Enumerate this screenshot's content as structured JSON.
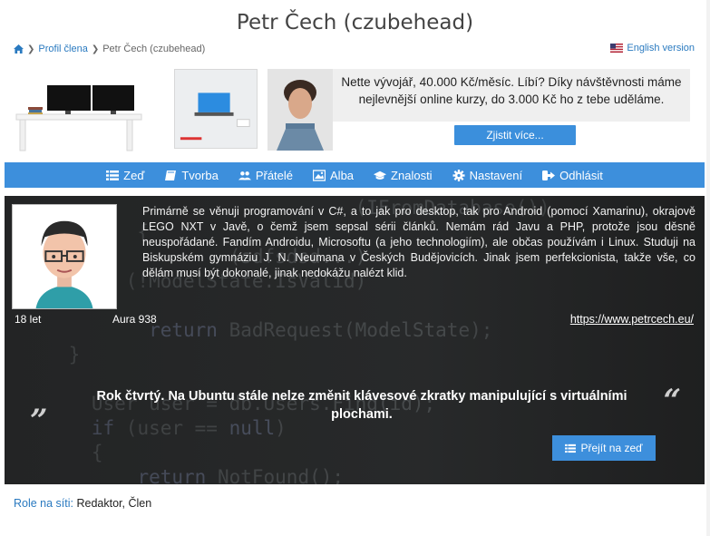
{
  "page": {
    "title": "Petr Čech (czubehead)"
  },
  "breadcrumb": {
    "items": [
      "Profil člena",
      "Petr Čech (czubehead)"
    ]
  },
  "language": {
    "label": "English version"
  },
  "banner": {
    "ad_text": "Nette vývojář, 40.000 Kč/měsíc. Líbí? Díky návštěvnosti máme nejlevnější online kurzy, do 3.000 Kč ho z tebe uděláme.",
    "button": "Zjistit více..."
  },
  "nav": {
    "items": [
      {
        "label": "Zeď",
        "icon": "list-icon"
      },
      {
        "label": "Tvorba",
        "icon": "book-icon"
      },
      {
        "label": "Přátelé",
        "icon": "users-icon"
      },
      {
        "label": "Alba",
        "icon": "image-icon"
      },
      {
        "label": "Znalosti",
        "icon": "graduation-cap-icon"
      },
      {
        "label": "Nastavení",
        "icon": "gear-icon"
      },
      {
        "label": "Odhlásit",
        "icon": "sign-out-icon"
      }
    ]
  },
  "profile": {
    "bio": "Primárně se věnuji programování v C#, a to jak pro desktop, tak pro Android (pomocí Xamarinu), okrajově LEGO NXT v Javě, o čemž jsem sepsal sérii článků. Nemám rád Javu a PHP, protože jsou děsně neuspořádané. Fandím Androidu, Microsoftu (a jeho technologiím), ale občas používám i Linux. Studuji na Biskupském gymnáziu J. N. Neumana v Českých Budějovicích. Jinak jsem perfekcionista, takže vše, co dělám musí být dokonalé, jinak nedokážu nalézt klid.",
    "age": "18 let",
    "aura": "Aura 938",
    "website": "https://www.petrcech.eu/",
    "status": "Rok čtvrtý. Na Ubuntu stále nelze změnit klávesové zkratky manipulující s virtuálními plochami.",
    "wall_button": "Přejít na zeď"
  },
  "roles": {
    "label": "Role na síti:",
    "value": "Redaktor, Člen"
  },
  "colors": {
    "accent": "#3d8fdc",
    "link": "#2a7ac0"
  }
}
